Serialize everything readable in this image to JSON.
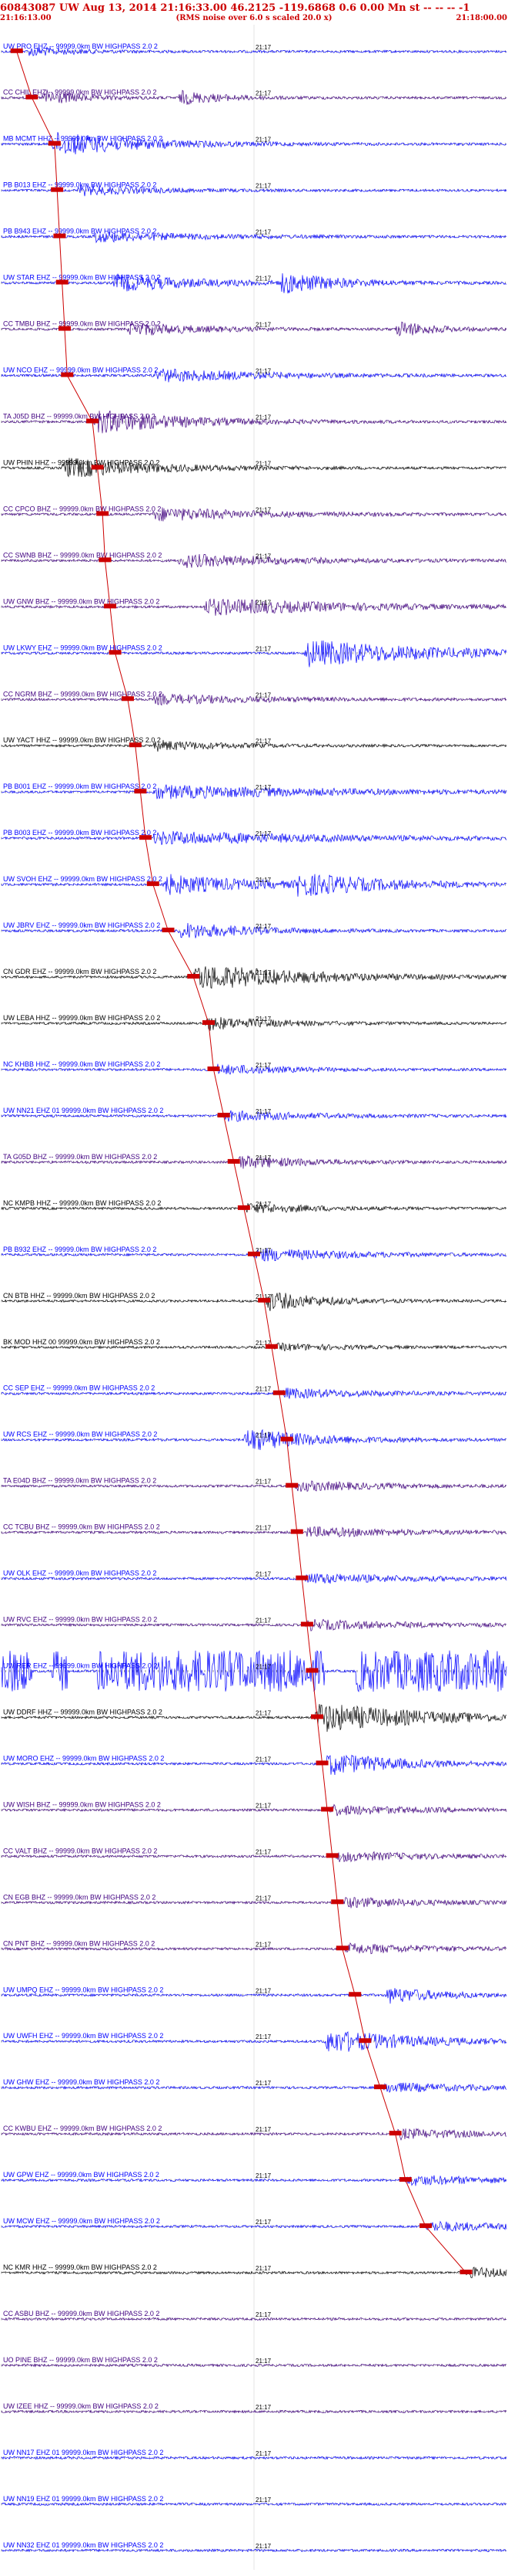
{
  "header": {
    "title": "60843087 UW Aug 13, 2014 21:16:33.00  46.2125 -119.6868  0.6 0.00 Mn st -- -- --  -1",
    "start_time": "21:16:13.00",
    "end_time": "21:18:00.00",
    "note": "(RMS noise over 6.0 s scaled 20.0 x)"
  },
  "colors": {
    "title": "#cc0000",
    "pick": "#cc0000",
    "traces": [
      "#0000ff",
      "#400080",
      "#000000"
    ]
  },
  "chart_data": {
    "type": "line",
    "title": "60843087 UW Aug 13, 2014 21:16:33.00  46.2125 -119.6868  0.6 0.00 Mn st -- -- --  -1",
    "xlabel": "",
    "ylabel": "",
    "x_range": [
      "21:16:13.00",
      "21:18:00.00"
    ],
    "time_mark": "21:17",
    "grid": false,
    "traces": [
      {
        "label": "UW PRO EHZ -- 99999.0km BW  HIGHPASS  2.0  2",
        "color": "#0000ff",
        "pick_fraction": 0.03,
        "bursts": [
          {
            "start": 0.05,
            "peak": 3,
            "decay": 0.12
          }
        ]
      },
      {
        "label": "CC CHIL EHZ -- 99999.0km BW  HIGHPASS  2.0  2",
        "color": "#400080",
        "pick_fraction": 0.06,
        "bursts": [
          {
            "start": 0.08,
            "peak": 5,
            "decay": 0.1
          },
          {
            "start": 0.35,
            "peak": 4,
            "decay": 0.12
          }
        ]
      },
      {
        "label": "MB MCMT HHZ -- 99999.0km BW  HIGHPASS  2.0  2",
        "color": "#0000ff",
        "pick_fraction": 0.105,
        "bursts": [
          {
            "start": 0.1,
            "peak": 7,
            "decay": 0.25
          }
        ]
      },
      {
        "label": "PB B013 EHZ -- 99999.0km BW  HIGHPASS  2.0  2",
        "color": "#0000ff",
        "pick_fraction": 0.11,
        "bursts": [
          {
            "start": 0.15,
            "peak": 3,
            "decay": 0.2
          }
        ]
      },
      {
        "label": "PB B943 EHZ -- 99999.0km BW  HIGHPASS  2.0  2",
        "color": "#0000ff",
        "pick_fraction": 0.115,
        "bursts": [
          {
            "start": 0.18,
            "peak": 3,
            "decay": 0.3
          }
        ]
      },
      {
        "label": "UW STAR EHZ -- 99999.0km BW  HIGHPASS  2.0  2",
        "color": "#0000ff",
        "pick_fraction": 0.12,
        "bursts": [
          {
            "start": 0.22,
            "peak": 5,
            "decay": 0.25
          },
          {
            "start": 0.55,
            "peak": 6,
            "decay": 0.15
          }
        ]
      },
      {
        "label": "CC TMBU BHZ -- 99999.0km BW  HIGHPASS  2.0  2",
        "color": "#400080",
        "pick_fraction": 0.125,
        "bursts": [
          {
            "start": 0.25,
            "peak": 4,
            "decay": 0.2
          },
          {
            "start": 0.78,
            "peak": 5,
            "decay": 0.1
          }
        ]
      },
      {
        "label": "UW NCO EHZ -- 99999.0km BW  HIGHPASS  2.0  2",
        "color": "#0000ff",
        "pick_fraction": 0.13,
        "bursts": [
          {
            "start": 0.3,
            "peak": 4,
            "decay": 0.3
          }
        ]
      },
      {
        "label": "TA J05D BHZ -- 99999.0km BW  HIGHPASS  2.0  2",
        "color": "#400080",
        "pick_fraction": 0.18,
        "bursts": [
          {
            "start": 0.18,
            "peak": 7,
            "decay": 0.25
          }
        ]
      },
      {
        "label": "UW PHIN HHZ -- 99999.0km BW  HIGHPASS  2.0  2",
        "color": "#000000",
        "pick_fraction": 0.19,
        "bursts": [
          {
            "start": 0.12,
            "peak": 6,
            "decay": 0.25
          }
        ]
      },
      {
        "label": "CC CPCO BHZ -- 99999.0km BW  HIGHPASS  2.0  2",
        "color": "#400080",
        "pick_fraction": 0.2,
        "bursts": [
          {
            "start": 0.3,
            "peak": 4,
            "decay": 0.3
          }
        ]
      },
      {
        "label": "CC SWNB BHZ -- 99999.0km BW  HIGHPASS  2.0  2",
        "color": "#400080",
        "pick_fraction": 0.205,
        "bursts": [
          {
            "start": 0.35,
            "peak": 4,
            "decay": 0.3
          }
        ]
      },
      {
        "label": "UW GNW BHZ -- 99999.0km BW  HIGHPASS  2.0  2",
        "color": "#400080",
        "pick_fraction": 0.215,
        "bursts": [
          {
            "start": 0.4,
            "peak": 5,
            "decay": 0.4
          }
        ]
      },
      {
        "label": "UW LKWY EHZ -- 99999.0km BW  HIGHPASS  2.0  2",
        "color": "#0000ff",
        "pick_fraction": 0.225,
        "bursts": [
          {
            "start": 0.6,
            "peak": 8,
            "decay": 0.35
          }
        ]
      },
      {
        "label": "CC NGRM BHZ -- 99999.0km BW  HIGHPASS  2.0  2",
        "color": "#400080",
        "pick_fraction": 0.25,
        "bursts": [
          {
            "start": 0.3,
            "peak": 3,
            "decay": 0.3
          }
        ]
      },
      {
        "label": "UW YACT HHZ -- 99999.0km BW  HIGHPASS  2.0  2",
        "color": "#000000",
        "pick_fraction": 0.265,
        "bursts": [
          {
            "start": 0.3,
            "peak": 3,
            "decay": 0.2
          }
        ]
      },
      {
        "label": "PB B001 EHZ -- 99999.0km BW  HIGHPASS  2.0  2",
        "color": "#0000ff",
        "pick_fraction": 0.275,
        "bursts": [
          {
            "start": 0.3,
            "peak": 4,
            "decay": 0.5
          }
        ]
      },
      {
        "label": "PB B003 EHZ -- 99999.0km BW  HIGHPASS  2.0  2",
        "color": "#0000ff",
        "pick_fraction": 0.285,
        "bursts": [
          {
            "start": 0.3,
            "peak": 4,
            "decay": 0.5
          }
        ]
      },
      {
        "label": "UW SVOH EHZ -- 99999.0km BW  HIGHPASS  2.0  2",
        "color": "#0000ff",
        "pick_fraction": 0.3,
        "bursts": [
          {
            "start": 0.32,
            "peak": 6,
            "decay": 0.25
          },
          {
            "start": 0.58,
            "peak": 6,
            "decay": 0.25
          }
        ]
      },
      {
        "label": "UW JBRV EHZ -- 99999.0km BW  HIGHPASS  2.0  2",
        "color": "#0000ff",
        "pick_fraction": 0.33,
        "bursts": [
          {
            "start": 0.35,
            "peak": 5,
            "decay": 0.2
          }
        ]
      },
      {
        "label": "CN GDR EHZ -- 99999.0km BW  HIGHPASS  2.0  2",
        "color": "#000000",
        "pick_fraction": 0.38,
        "bursts": [
          {
            "start": 0.38,
            "peak": 8,
            "decay": 0.3
          }
        ]
      },
      {
        "label": "UW LEBA HHZ -- 99999.0km BW  HIGHPASS  2.0  2",
        "color": "#000000",
        "pick_fraction": 0.41,
        "bursts": [
          {
            "start": 0.4,
            "peak": 4,
            "decay": 0.2
          }
        ]
      },
      {
        "label": "NC KHBB HHZ -- 99999.0km BW  HIGHPASS  2.0  2",
        "color": "#0000ff",
        "pick_fraction": 0.42,
        "bursts": [
          {
            "start": 0.42,
            "peak": 3,
            "decay": 0.2
          }
        ]
      },
      {
        "label": "UW NN21 EHZ 01 99999.0km BW  HIGHPASS  2.0  2",
        "color": "#0000ff",
        "pick_fraction": 0.44,
        "bursts": [
          {
            "start": 0.44,
            "peak": 3,
            "decay": 0.25
          }
        ]
      },
      {
        "label": "TA G05D BHZ -- 99999.0km BW  HIGHPASS  2.0  2",
        "color": "#400080",
        "pick_fraction": 0.46,
        "bursts": [
          {
            "start": 0.46,
            "peak": 4,
            "decay": 0.2
          }
        ]
      },
      {
        "label": "NC KMPB HHZ -- 99999.0km BW  HIGHPASS  2.0  2",
        "color": "#000000",
        "pick_fraction": 0.48,
        "bursts": [
          {
            "start": 0.48,
            "peak": 3,
            "decay": 0.2
          }
        ]
      },
      {
        "label": "PB B932 EHZ -- 99999.0km BW  HIGHPASS  2.0  2",
        "color": "#0000ff",
        "pick_fraction": 0.5,
        "bursts": [
          {
            "start": 0.5,
            "peak": 4,
            "decay": 0.25
          }
        ]
      },
      {
        "label": "CN BTB HHZ -- 99999.0km BW  HIGHPASS  2.0  2",
        "color": "#000000",
        "pick_fraction": 0.52,
        "bursts": [
          {
            "start": 0.52,
            "peak": 6,
            "decay": 0.15
          }
        ]
      },
      {
        "label": "BK MOD HHZ 00 99999.0km BW  HIGHPASS  2.0  2",
        "color": "#000000",
        "pick_fraction": 0.535,
        "bursts": [
          {
            "start": 0.54,
            "peak": 2,
            "decay": 0.2
          }
        ]
      },
      {
        "label": "CC SEP EHZ -- 99999.0km BW  HIGHPASS  2.0  2",
        "color": "#0000ff",
        "pick_fraction": 0.55,
        "bursts": [
          {
            "start": 0.55,
            "peak": 3,
            "decay": 0.25
          }
        ]
      },
      {
        "label": "UW RCS EHZ -- 99999.0km BW  HIGHPASS  2.0  2",
        "color": "#0000ff",
        "pick_fraction": 0.565,
        "bursts": [
          {
            "start": 0.48,
            "peak": 7,
            "decay": 0.2
          }
        ]
      },
      {
        "label": "TA E04D BHZ -- 99999.0km BW  HIGHPASS  2.0  2",
        "color": "#400080",
        "pick_fraction": 0.575,
        "bursts": [
          {
            "start": 0.58,
            "peak": 3,
            "decay": 0.25
          }
        ]
      },
      {
        "label": "CC TCBU BHZ -- 99999.0km BW  HIGHPASS  2.0  2",
        "color": "#400080",
        "pick_fraction": 0.585,
        "bursts": [
          {
            "start": 0.6,
            "peak": 3,
            "decay": 0.3
          }
        ]
      },
      {
        "label": "UW OLK EHZ -- 99999.0km BW  HIGHPASS  2.0  2",
        "color": "#0000ff",
        "pick_fraction": 0.595,
        "bursts": [
          {
            "start": 0.6,
            "peak": 3,
            "decay": 0.3
          }
        ]
      },
      {
        "label": "UW RVC EHZ -- 99999.0km BW  HIGHPASS  2.0  2",
        "color": "#400080",
        "pick_fraction": 0.605,
        "bursts": [
          {
            "start": 0.6,
            "peak": 3,
            "decay": 0.3
          }
        ]
      },
      {
        "label": "UW RER EHZ -- 99999.0km BW  HIGHPASS  2.0  2",
        "color": "#0000ff",
        "pick_fraction": 0.615,
        "saturated_spans": [
          [
            0.0,
            0.06
          ],
          [
            0.1,
            0.13
          ],
          [
            0.19,
            0.64
          ],
          [
            0.7,
            1.0
          ]
        ]
      },
      {
        "label": "UW DDRF HHZ -- 99999.0km BW  HIGHPASS  2.0  2",
        "color": "#000000",
        "pick_fraction": 0.625,
        "bursts": [
          {
            "start": 0.62,
            "peak": 9,
            "decay": 0.3
          }
        ]
      },
      {
        "label": "UW MORO EHZ -- 99999.0km BW  HIGHPASS  2.0  2",
        "color": "#0000ff",
        "pick_fraction": 0.635,
        "bursts": [
          {
            "start": 0.64,
            "peak": 7,
            "decay": 0.2
          }
        ]
      },
      {
        "label": "UW WISH BHZ -- 99999.0km BW  HIGHPASS  2.0  2",
        "color": "#400080",
        "pick_fraction": 0.645,
        "bursts": [
          {
            "start": 0.65,
            "peak": 3,
            "decay": 0.25
          }
        ]
      },
      {
        "label": "CC VALT BHZ -- 99999.0km BW  HIGHPASS  2.0  2",
        "color": "#400080",
        "pick_fraction": 0.655,
        "bursts": [
          {
            "start": 0.66,
            "peak": 3,
            "decay": 0.25
          }
        ]
      },
      {
        "label": "CN EGB BHZ -- 99999.0km BW  HIGHPASS  2.0  2",
        "color": "#400080",
        "pick_fraction": 0.665,
        "bursts": [
          {
            "start": 0.67,
            "peak": 3,
            "decay": 0.25
          }
        ]
      },
      {
        "label": "CN PNT BHZ -- 99999.0km BW  HIGHPASS  2.0  2",
        "color": "#400080",
        "pick_fraction": 0.675,
        "bursts": [
          {
            "start": 0.68,
            "peak": 3,
            "decay": 0.25
          }
        ]
      },
      {
        "label": "UW UMPQ EHZ -- 99999.0km BW  HIGHPASS  2.0  2",
        "color": "#0000ff",
        "pick_fraction": 0.7,
        "bursts": [
          {
            "start": 0.76,
            "peak": 5,
            "decay": 0.15
          }
        ]
      },
      {
        "label": "UW UWFH EHZ -- 99999.0km BW  HIGHPASS  2.0  2",
        "color": "#0000ff",
        "pick_fraction": 0.72,
        "bursts": [
          {
            "start": 0.64,
            "peak": 7,
            "decay": 0.25
          }
        ]
      },
      {
        "label": "UW GHW EHZ -- 99999.0km BW  HIGHPASS  2.0  2",
        "color": "#0000ff",
        "pick_fraction": 0.75,
        "bursts": [
          {
            "start": 0.75,
            "peak": 3,
            "decay": 0.25
          }
        ]
      },
      {
        "label": "CC KWBU EHZ -- 99999.0km BW  HIGHPASS  2.0  2",
        "color": "#400080",
        "pick_fraction": 0.78,
        "bursts": [
          {
            "start": 0.78,
            "peak": 3,
            "decay": 0.25
          }
        ]
      },
      {
        "label": "UW GPW EHZ -- 99999.0km BW  HIGHPASS  2.0  2",
        "color": "#0000ff",
        "pick_fraction": 0.8,
        "bursts": [
          {
            "start": 0.8,
            "peak": 3,
            "decay": 0.25
          }
        ]
      },
      {
        "label": "UW MCW EHZ -- 99999.0km BW  HIGHPASS  2.0  2",
        "color": "#0000ff",
        "pick_fraction": 0.84,
        "bursts": [
          {
            "start": 0.84,
            "peak": 3,
            "decay": 0.25
          }
        ]
      },
      {
        "label": "NC KMR HHZ -- 99999.0km BW  HIGHPASS  2.0  2",
        "color": "#000000",
        "pick_fraction": 0.92,
        "bursts": [
          {
            "start": 0.92,
            "peak": 3,
            "decay": 0.2
          }
        ]
      },
      {
        "label": "CC ASBU BHZ -- 99999.0km BW  HIGHPASS  2.0  2",
        "color": "#400080",
        "bursts": []
      },
      {
        "label": "UO PINE BHZ -- 99999.0km BW  HIGHPASS  2.0  2",
        "color": "#400080",
        "bursts": []
      },
      {
        "label": "UW IZEE HHZ -- 99999.0km BW  HIGHPASS  2.0  2",
        "color": "#400080",
        "bursts": []
      },
      {
        "label": "UW NN17 EHZ 01 99999.0km BW  HIGHPASS  2.0  2",
        "color": "#0000ff",
        "bursts": []
      },
      {
        "label": "UW NN19 EHZ 01 99999.0km BW  HIGHPASS  2.0  2",
        "color": "#0000ff",
        "bursts": []
      },
      {
        "label": "UW NN32 EHZ 01 99999.0km BW  HIGHPASS  2.0  2",
        "color": "#0000ff",
        "bursts": []
      }
    ]
  }
}
